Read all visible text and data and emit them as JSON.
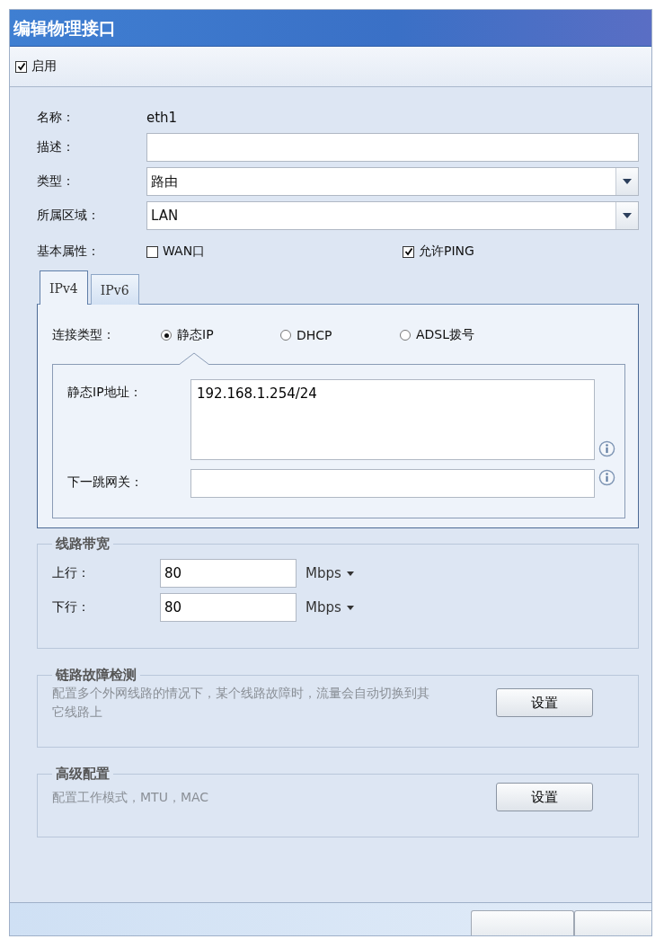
{
  "window": {
    "title": "编辑物理接口"
  },
  "enable": {
    "label": "启用",
    "checked": true
  },
  "fields": [
    {
      "kind": "text",
      "label": "名称：",
      "value": "eth1"
    },
    {
      "kind": "input",
      "label": "描述："
    },
    {
      "kind": "select",
      "label": "类型：",
      "value": "路由"
    },
    {
      "kind": "select",
      "label": "所属区域：",
      "value": "LAN"
    }
  ],
  "properties": {
    "label": "基本属性：",
    "options": [
      {
        "label": "WAN口",
        "checked": false
      },
      {
        "label": "允许PING",
        "checked": true
      }
    ]
  },
  "tabs": [
    {
      "label": "IPv4",
      "selected": true
    },
    {
      "label": "IPv6",
      "selected": false
    }
  ],
  "connection": {
    "label": "连接类型：",
    "options": [
      {
        "label": "静态IP",
        "selected": true
      },
      {
        "label": "DHCP",
        "selected": false
      },
      {
        "label": "ADSL拨号",
        "selected": false
      }
    ]
  },
  "static_fields": [
    {
      "kind": "textarea",
      "label": "静态IP地址：",
      "value": "192.168.1.254/24"
    },
    {
      "kind": "input",
      "label": "下一跳网关："
    }
  ],
  "bandwidth": {
    "title": "线路带宽",
    "rows": [
      {
        "label": "上行：",
        "value": "80",
        "unit": "Mbps"
      },
      {
        "label": "下行：",
        "value": "80",
        "unit": "Mbps"
      }
    ]
  },
  "sections": [
    {
      "title": "链路故障检测",
      "description": "配置多个外网线路的情况下，某个线路故障时，流量会自动切换到其它线路上",
      "button": "设置"
    },
    {
      "title": "高级配置",
      "description": "配置工作模式，MTU，MAC",
      "button": "设置"
    }
  ],
  "footer": {
    "buttons": [
      {
        "kind": "blank"
      },
      {
        "kind": "blank"
      }
    ]
  }
}
